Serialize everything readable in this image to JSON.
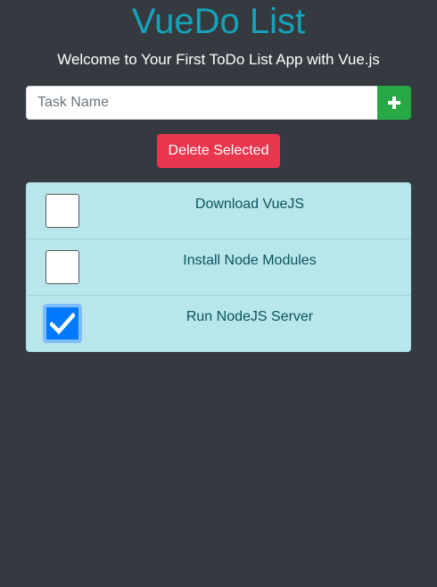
{
  "header": {
    "title": "VueDo List",
    "subtitle": "Welcome to Your First ToDo List App with Vue.js"
  },
  "form": {
    "task_input_placeholder": "Task Name",
    "task_input_value": "",
    "add_icon": "plus-icon",
    "delete_label": "Delete Selected"
  },
  "tasks": [
    {
      "label": "Download VueJS",
      "checked": false
    },
    {
      "label": "Install Node Modules",
      "checked": false
    },
    {
      "label": "Run NodeJS Server",
      "checked": true
    }
  ],
  "colors": {
    "background": "#343a40",
    "title": "#17a2b8",
    "add_button": "#28a745",
    "delete_button": "#e8364e",
    "list_background": "#b9e6ea",
    "checkbox_checked": "#007bff"
  }
}
